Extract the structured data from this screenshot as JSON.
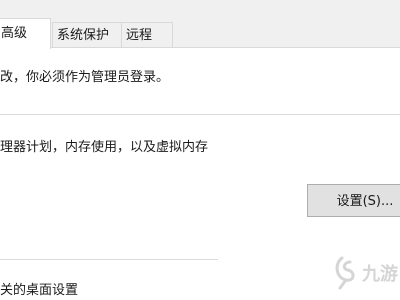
{
  "tabs": [
    {
      "label": "高级",
      "active": true
    },
    {
      "label": "系统保护",
      "active": false
    },
    {
      "label": "远程",
      "active": false
    }
  ],
  "content": {
    "admin_notice": "改，你必须作为管理员登录。",
    "performance_desc": "理器计划，内存使用，以及虚拟内存",
    "settings_button": "设置(S)...",
    "desktop_settings": "关的桌面设置"
  },
  "watermark": {
    "text": "九游",
    "icon": "swirl-logo-icon"
  },
  "colors": {
    "tab_strip_bg": "#f0f0f0",
    "button_bg": "#e1e1e1",
    "button_border": "#adadad",
    "watermark": "#8a8a8a"
  }
}
